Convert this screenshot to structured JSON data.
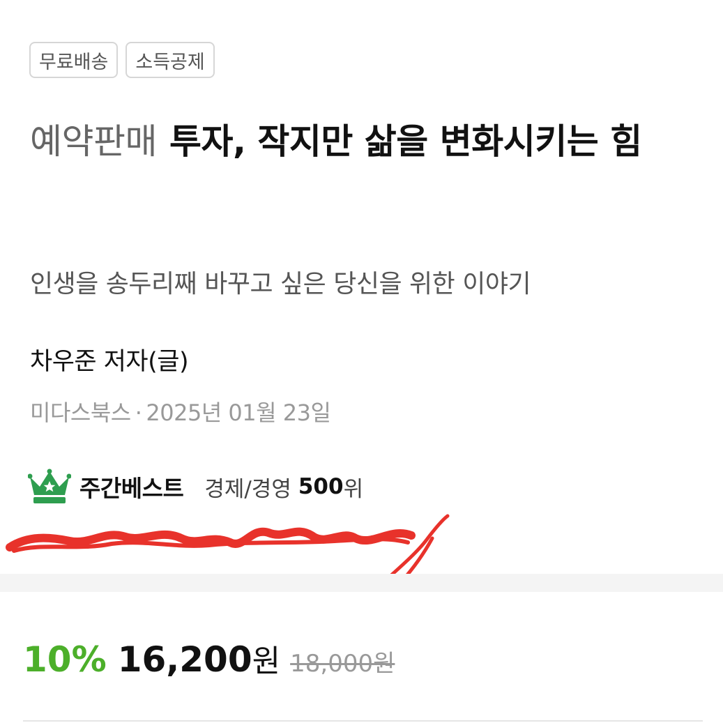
{
  "tags": [
    "무료배송",
    "소득공제"
  ],
  "book": {
    "status": "예약판매",
    "title": "투자, 작지만 삶을 변화시키는 힘",
    "subtitle": "인생을 송두리째 바꾸고 싶은 당신을 위한 이야기",
    "author": "차우준 저자(글)",
    "publisher": "미다스북스",
    "separator": "·",
    "pub_date": "2025년 01월 23일"
  },
  "bestseller": {
    "icon": "crown-icon",
    "label": "주간베스트",
    "category": "경제/경영",
    "rank": "500",
    "rank_unit": "위"
  },
  "price": {
    "discount": "10%",
    "sale_price": "16,200",
    "currency": "원",
    "original_price": "18,000원"
  },
  "colors": {
    "accent_green": "#4caf2a",
    "scribble_red": "#e8322b"
  }
}
